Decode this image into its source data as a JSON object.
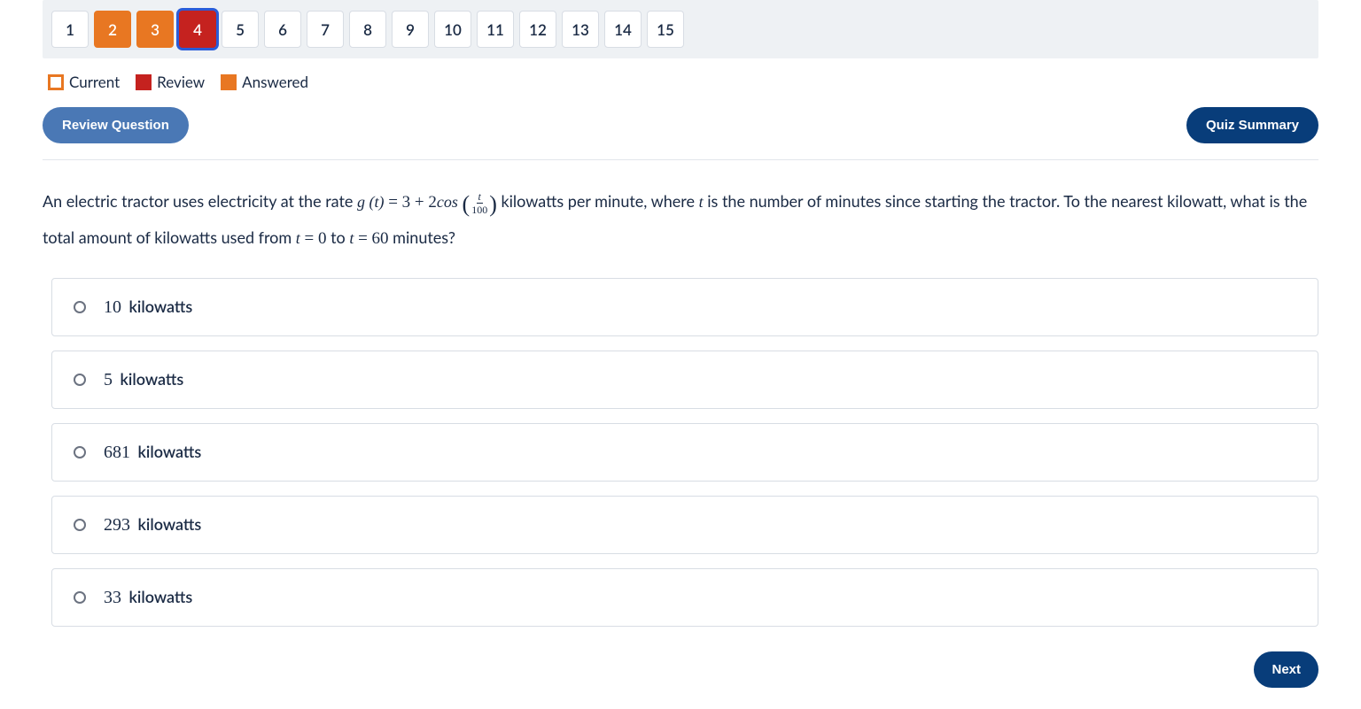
{
  "nav": {
    "items": [
      {
        "n": "1",
        "state": ""
      },
      {
        "n": "2",
        "state": "answered"
      },
      {
        "n": "3",
        "state": "answered"
      },
      {
        "n": "4",
        "state": "review current"
      },
      {
        "n": "5",
        "state": ""
      },
      {
        "n": "6",
        "state": ""
      },
      {
        "n": "7",
        "state": ""
      },
      {
        "n": "8",
        "state": ""
      },
      {
        "n": "9",
        "state": ""
      },
      {
        "n": "10",
        "state": ""
      },
      {
        "n": "11",
        "state": ""
      },
      {
        "n": "12",
        "state": ""
      },
      {
        "n": "13",
        "state": ""
      },
      {
        "n": "14",
        "state": ""
      },
      {
        "n": "15",
        "state": ""
      }
    ]
  },
  "legend": {
    "current": "Current",
    "review": "Review",
    "answered": "Answered"
  },
  "buttons": {
    "review": "Review Question",
    "summary": "Quiz Summary",
    "next": "Next"
  },
  "question": {
    "pre": "An electric tractor uses electricity at the rate ",
    "g_of_t": "g (t)",
    "eq": " = 3 + 2",
    "cos": "cos",
    "frac_num": "t",
    "frac_den": "100",
    "mid": " kilowatts per minute, where ",
    "t": "t",
    "post1": " is the number of minutes since starting the tractor. To the nearest kilowatt, what is the total amount of kilowatts used from ",
    "t0": "t",
    "eq0": " = 0",
    "to": " to ",
    "t1": "t",
    "eq1": " = 60",
    "post2": " minutes?"
  },
  "options": [
    {
      "num": "10",
      "unit": "kilowatts"
    },
    {
      "num": "5",
      "unit": "kilowatts"
    },
    {
      "num": "681",
      "unit": "kilowatts"
    },
    {
      "num": "293",
      "unit": "kilowatts"
    },
    {
      "num": "33",
      "unit": "kilowatts"
    }
  ]
}
